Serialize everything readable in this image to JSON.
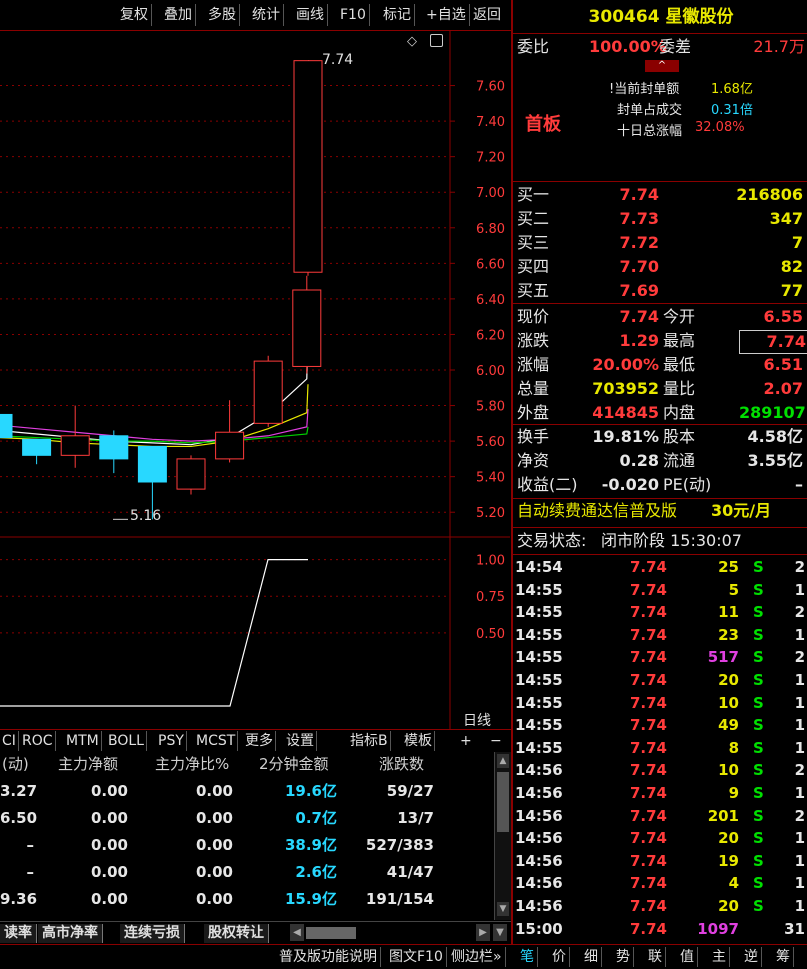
{
  "toolbar": {
    "items": [
      "复权",
      "叠加",
      "多股",
      "统计",
      "画线",
      "F10",
      "标记",
      "+自选",
      "返回"
    ]
  },
  "chart": {
    "price_ticks": [
      "7.60",
      "7.40",
      "7.20",
      "7.00",
      "6.80",
      "6.60",
      "6.40",
      "6.20",
      "6.00",
      "5.80",
      "5.60",
      "5.40",
      "5.20"
    ],
    "osc_ticks": [
      "1.00",
      "0.75",
      "0.50"
    ],
    "high_label": "7.74",
    "low_label": "5.16",
    "period_label": "日线",
    "plus": "+",
    "minus": "−",
    "icons": [
      "diamond-icon",
      "window-icon"
    ]
  },
  "chart_data": {
    "type": "candlestick",
    "candles": [
      {
        "open": 5.62,
        "close": 5.75,
        "high": 5.75,
        "low": 5.6,
        "dir": "up",
        "color": "cyan-fill"
      },
      {
        "open": 5.61,
        "close": 5.52,
        "high": 5.61,
        "low": 5.47,
        "dir": "down"
      },
      {
        "open": 5.52,
        "close": 5.63,
        "high": 5.8,
        "low": 5.45,
        "dir": "up"
      },
      {
        "open": 5.63,
        "close": 5.5,
        "high": 5.66,
        "low": 5.42,
        "dir": "down"
      },
      {
        "open": 5.57,
        "close": 5.37,
        "high": 5.57,
        "low": 5.16,
        "dir": "down"
      },
      {
        "open": 5.33,
        "close": 5.5,
        "high": 5.52,
        "low": 5.3,
        "dir": "up"
      },
      {
        "open": 5.5,
        "close": 5.65,
        "high": 5.83,
        "low": 5.48,
        "dir": "up"
      },
      {
        "open": 5.7,
        "close": 6.05,
        "high": 6.08,
        "low": 5.68,
        "dir": "up"
      },
      {
        "open": 6.02,
        "close": 6.45,
        "high": 6.53,
        "low": 5.98,
        "dir": "up"
      },
      {
        "open": 6.55,
        "close": 7.74,
        "high": 7.74,
        "low": 6.53,
        "dir": "up"
      }
    ],
    "ylim": [
      5.1,
      7.8
    ],
    "osc_series": [
      0,
      0,
      0,
      0,
      0,
      0,
      0,
      0,
      0.05,
      1.0,
      1.0
    ],
    "osc_ylim": [
      0,
      1.1
    ]
  },
  "indicator_tabs": [
    "CI",
    "ROC",
    "MTM",
    "BOLL",
    "PSY",
    "MCST",
    "更多",
    "设置",
    "指标B",
    "模板"
  ],
  "table": {
    "headers": [
      "(动)",
      "主力净额",
      "主力净比%",
      "2分钟金额",
      "涨跌数"
    ],
    "rows": [
      [
        "3.27",
        "0.00",
        "0.00",
        "19.6亿",
        "59/27"
      ],
      [
        "6.50",
        "0.00",
        "0.00",
        "0.7亿",
        "13/7"
      ],
      [
        "–",
        "0.00",
        "0.00",
        "38.9亿",
        "527/383"
      ],
      [
        "–",
        "0.00",
        "0.00",
        "2.6亿",
        "41/47"
      ],
      [
        "9.36",
        "0.00",
        "0.00",
        "15.9亿",
        "191/154"
      ]
    ]
  },
  "bottom_tabs": [
    "读率",
    "高市净率",
    "连续亏损",
    "股权转让"
  ],
  "bottom_bar": [
    "普及版功能说明",
    "图文F10",
    "侧边栏»"
  ],
  "right_bottom_tabs": [
    "笔",
    "价",
    "细",
    "势",
    "联",
    "值",
    "主",
    "逆",
    "筹"
  ],
  "stock": {
    "code": "300464",
    "name": "星徽股份"
  },
  "weibi": {
    "label": "委比",
    "value": "100.00%",
    "diff_label": "委差",
    "diff": "21.7万"
  },
  "fengban": {
    "tag": "首板",
    "line1_label": "当前封单额",
    "line1_value": "1.68亿",
    "line2_label": "封单占成交",
    "line2_value": "0.31倍",
    "line3_label": "十日总涨幅",
    "line3_value": "32.08%"
  },
  "bids": [
    {
      "label": "买一",
      "price": "7.74",
      "vol": "216806"
    },
    {
      "label": "买二",
      "price": "7.73",
      "vol": "347"
    },
    {
      "label": "买三",
      "price": "7.72",
      "vol": "7"
    },
    {
      "label": "买四",
      "price": "7.70",
      "vol": "82"
    },
    {
      "label": "买五",
      "price": "7.69",
      "vol": "77"
    }
  ],
  "quote": [
    {
      "l": "现价",
      "v": "7.74",
      "l2": "今开",
      "v2": "6.55"
    },
    {
      "l": "涨跌",
      "v": "1.29",
      "l2": "最高",
      "v2": "7.74"
    },
    {
      "l": "涨幅",
      "v": "20.00%",
      "l2": "最低",
      "v2": "6.51"
    },
    {
      "l": "总量",
      "v": "703952",
      "l2": "量比",
      "v2": "2.07"
    },
    {
      "l": "外盘",
      "v": "414845",
      "l2": "内盘",
      "v2": "289107"
    }
  ],
  "stats": [
    {
      "l": "换手",
      "v": "19.81%",
      "l2": "股本",
      "v2": "4.58亿"
    },
    {
      "l": "净资",
      "v": "0.28",
      "l2": "流通",
      "v2": "3.55亿"
    },
    {
      "l": "收益(二)",
      "v": "-0.020",
      "l2": "PE(动)",
      "v2": "–"
    }
  ],
  "ad": {
    "text": "自动续费通达信普及版",
    "price": "30元/月"
  },
  "trade_status": {
    "label": "交易状态:",
    "value": "闭市阶段 15:30:07"
  },
  "ticks": [
    {
      "t": "14:54",
      "p": "7.74",
      "v": "25",
      "s": "S",
      "n": "2"
    },
    {
      "t": "14:55",
      "p": "7.74",
      "v": "5",
      "s": "S",
      "n": "1"
    },
    {
      "t": "14:55",
      "p": "7.74",
      "v": "11",
      "s": "S",
      "n": "2"
    },
    {
      "t": "14:55",
      "p": "7.74",
      "v": "23",
      "s": "S",
      "n": "1"
    },
    {
      "t": "14:55",
      "p": "7.74",
      "v": "517",
      "s": "S",
      "n": "2"
    },
    {
      "t": "14:55",
      "p": "7.74",
      "v": "20",
      "s": "S",
      "n": "1"
    },
    {
      "t": "14:55",
      "p": "7.74",
      "v": "10",
      "s": "S",
      "n": "1"
    },
    {
      "t": "14:55",
      "p": "7.74",
      "v": "49",
      "s": "S",
      "n": "1"
    },
    {
      "t": "14:55",
      "p": "7.74",
      "v": "8",
      "s": "S",
      "n": "1"
    },
    {
      "t": "14:56",
      "p": "7.74",
      "v": "10",
      "s": "S",
      "n": "2"
    },
    {
      "t": "14:56",
      "p": "7.74",
      "v": "9",
      "s": "S",
      "n": "1"
    },
    {
      "t": "14:56",
      "p": "7.74",
      "v": "201",
      "s": "S",
      "n": "2"
    },
    {
      "t": "14:56",
      "p": "7.74",
      "v": "20",
      "s": "S",
      "n": "1"
    },
    {
      "t": "14:56",
      "p": "7.74",
      "v": "19",
      "s": "S",
      "n": "1"
    },
    {
      "t": "14:56",
      "p": "7.74",
      "v": "4",
      "s": "S",
      "n": "1"
    },
    {
      "t": "14:56",
      "p": "7.74",
      "v": "20",
      "s": "S",
      "n": "1"
    },
    {
      "t": "15:00",
      "p": "7.74",
      "v": "1097",
      "s": "",
      "n": "31"
    }
  ],
  "colors": {
    "up": "#ff3b3b",
    "down": "#28d8ff",
    "grid": "#8a0000",
    "ma1": "#ffffff",
    "ma2": "#e8e800",
    "ma3": "#e040e0",
    "ma4": "#00d000"
  }
}
